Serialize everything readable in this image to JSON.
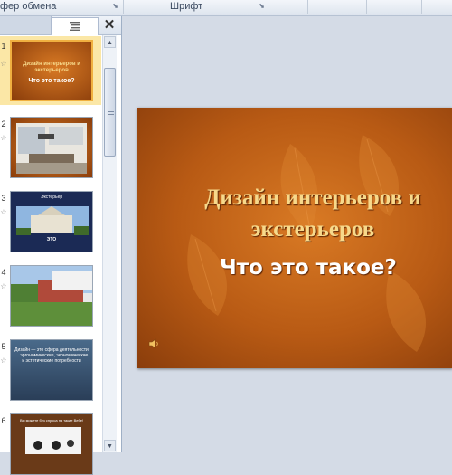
{
  "ribbon": {
    "clipboard_group": "фер обмена",
    "font_group": "Шрифт"
  },
  "panel": {
    "close_symbol": "✕",
    "slides": [
      {
        "number": "1",
        "title_line1": "Дизайн интерьеров и",
        "title_line2": "экстерьеров",
        "subtitle": "Что это такое?"
      },
      {
        "number": "2",
        "text": ""
      },
      {
        "number": "3",
        "caption_top": "Экстерьер",
        "caption_mid": "ЭТО"
      },
      {
        "number": "4",
        "text": ""
      },
      {
        "number": "5",
        "text": "Дизайн — это сфера деятельности ... эргономические, экономические и эстетические потребности"
      },
      {
        "number": "6",
        "text": "Вы можете без спроса на такие Вебе!"
      }
    ]
  },
  "slide": {
    "title": "Дизайн интерьеров и экстерьеров",
    "subtitle": "Что это такое?"
  },
  "colors": {
    "slide_accent": "#b85a14",
    "title_color": "#f7d98b",
    "selection": "#fbe7a6"
  }
}
